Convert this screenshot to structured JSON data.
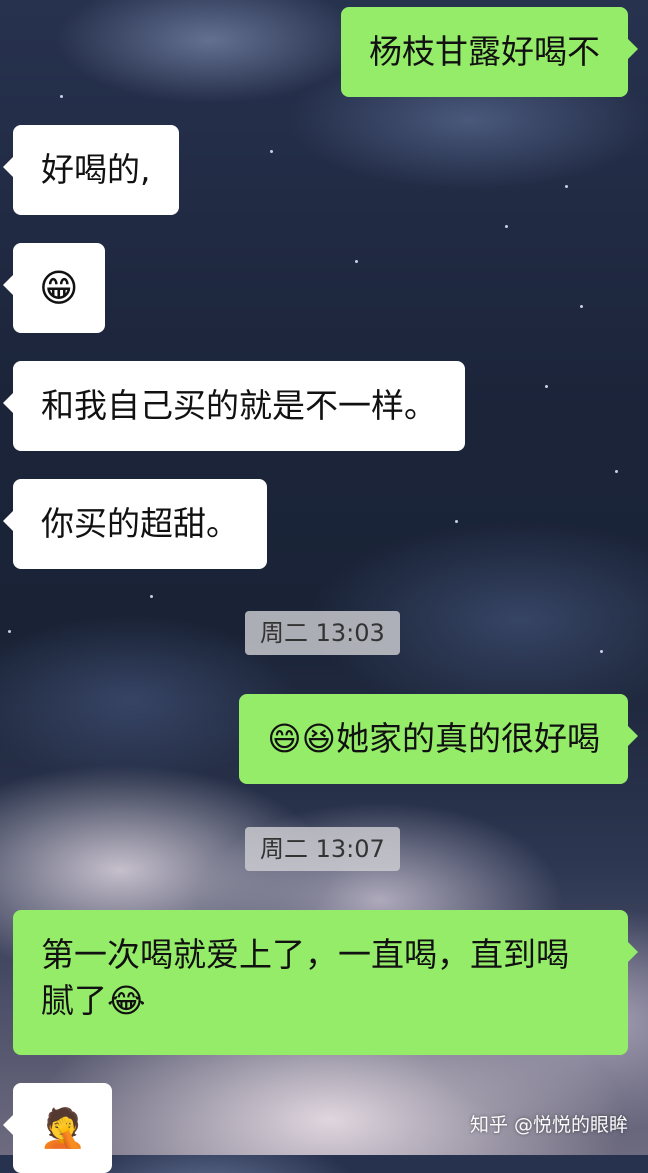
{
  "messages": [
    {
      "side": "right",
      "text": "杨枝甘露好喝不"
    },
    {
      "side": "left",
      "text": "好喝的,"
    },
    {
      "side": "left",
      "text": "😁"
    },
    {
      "side": "left",
      "text": "和我自己买的就是不一样。"
    },
    {
      "side": "left",
      "text": "你买的超甜。"
    },
    {
      "type": "timestamp",
      "text": "周二 13:03"
    },
    {
      "side": "right",
      "text": "😄😆她家的真的很好喝"
    },
    {
      "type": "timestamp",
      "text": "周二 13:07"
    },
    {
      "side": "right",
      "text": "第一次喝就爱上了，一直喝，直到喝腻了😂"
    },
    {
      "side": "left",
      "text": "🤦"
    }
  ],
  "watermark": "知乎 @悦悦的眼眸",
  "colors": {
    "bubble_sent": "#95ec69",
    "bubble_received": "#ffffff",
    "timestamp_bg": "#cdcdd2"
  }
}
